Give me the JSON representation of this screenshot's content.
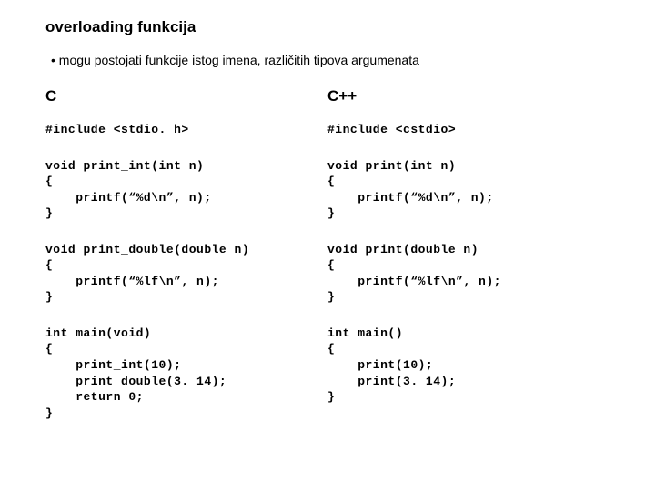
{
  "title": "overloading funkcija",
  "bullet": "• mogu postojati funkcije istog imena, različitih tipova argumenata",
  "left": {
    "header": "C",
    "block1": "#include <stdio. h>",
    "block2": "void print_int(int n)\n{\n    printf(“%d\\n”, n);\n}",
    "block3": "void print_double(double n)\n{\n    printf(“%lf\\n”, n);\n}",
    "block4": "int main(void)\n{\n    print_int(10);\n    print_double(3. 14);\n    return 0;\n}"
  },
  "right": {
    "header": "C++",
    "block1": "#include <cstdio>",
    "block2": "void print(int n)\n{\n    printf(“%d\\n”, n);\n}",
    "block3": "void print(double n)\n{\n    printf(“%lf\\n”, n);\n}",
    "block4": "int main()\n{\n    print(10);\n    print(3. 14);\n}"
  }
}
